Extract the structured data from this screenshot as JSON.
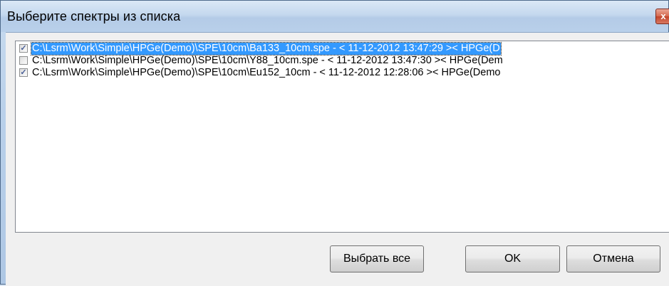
{
  "window": {
    "title": "Выберите спектры из списка",
    "close_glyph": "x"
  },
  "spectra_list": {
    "items": [
      {
        "checked": true,
        "selected": true,
        "label": "C:\\Lsrm\\Work\\Simple\\HPGe(Demo)\\SPE\\10cm\\Ba133_10cm.spe - < 11-12-2012 13:47:29 >< HPGe(D"
      },
      {
        "checked": false,
        "selected": false,
        "label": "C:\\Lsrm\\Work\\Simple\\HPGe(Demo)\\SPE\\10cm\\Y88_10cm.spe - < 11-12-2012 13:47:30 >< HPGe(Dem"
      },
      {
        "checked": true,
        "selected": false,
        "label": "C:\\Lsrm\\Work\\Simple\\HPGe(Demo)\\SPE\\10cm\\Eu152_10cm - < 11-12-2012 12:28:06 >< HPGe(Demo"
      }
    ]
  },
  "buttons": {
    "select_all": "Выбрать все",
    "ok": "OK",
    "cancel": "Отмена"
  },
  "colors": {
    "selection": "#3399ff",
    "check_mark": "#4a5f97"
  }
}
